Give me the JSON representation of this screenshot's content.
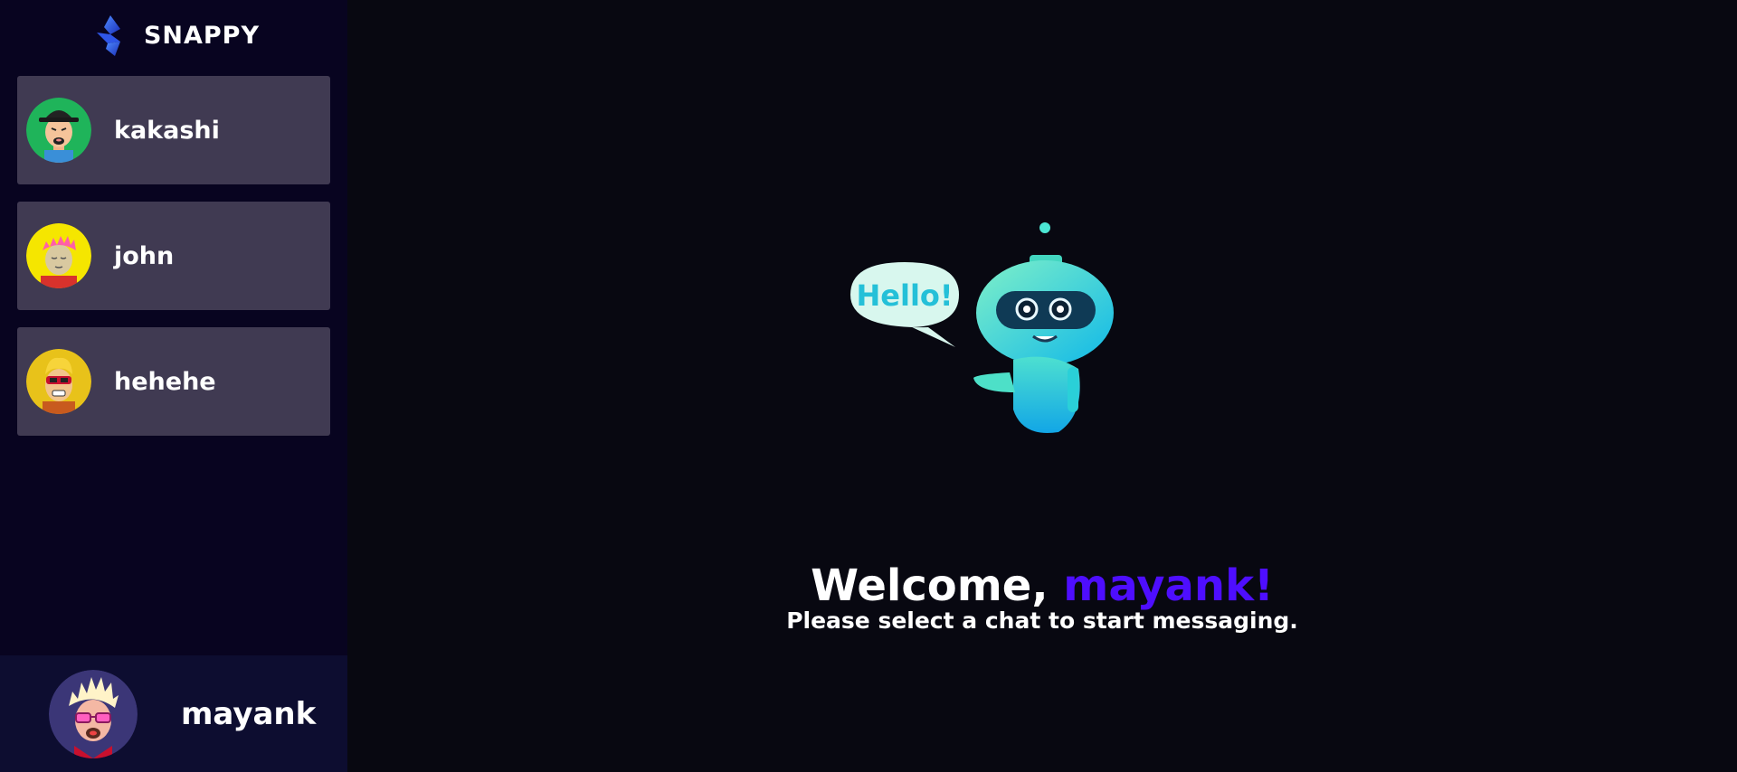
{
  "app": {
    "brand_name": "SNAPPY",
    "brand_icon": "snappy-logo-icon"
  },
  "sidebar": {
    "contacts": [
      {
        "name": "kakashi",
        "avatar": "avatar-green-hat"
      },
      {
        "name": "john",
        "avatar": "avatar-pink-hair"
      },
      {
        "name": "hehehe",
        "avatar": "avatar-sunglasses"
      }
    ],
    "current_user": {
      "name": "mayank",
      "avatar": "avatar-spiky-hair"
    }
  },
  "main": {
    "welcome_prefix": "Welcome, ",
    "welcome_name": "mayank!",
    "subtitle": "Please select a chat to start messaging.",
    "robot_bubble_text": "Hello!"
  },
  "colors": {
    "accent": "#4e0eff",
    "sidebar_bg": "#080420",
    "contact_bg": "#403a52",
    "current_user_bg": "#0d0d30",
    "main_bg": "#080811"
  }
}
